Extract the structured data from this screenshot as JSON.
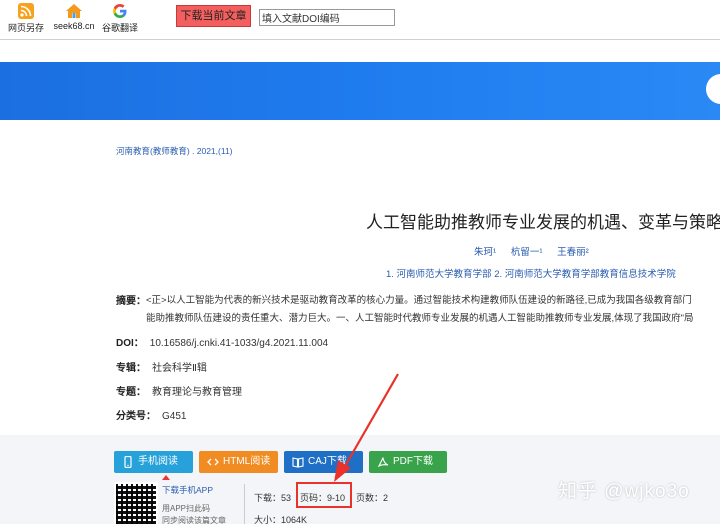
{
  "toolbar": {
    "items": [
      {
        "label": "网页另存",
        "icon": "rss-save-icon"
      },
      {
        "label": "seek68.cn",
        "icon": "home-icon"
      },
      {
        "label": "谷歌翻译",
        "icon": "google-icon"
      }
    ],
    "download_current": "下载当前文章",
    "doi_input_value": "填入文献DOI编码"
  },
  "article": {
    "source": "河南教育(教师教育) . 2021,(11)",
    "title": "人工智能助推教师专业发展的机遇、变革与策略",
    "authors": [
      "朱珂¹",
      "杭留一¹",
      "王春丽²"
    ],
    "affiliations": "1. 河南师范大学教育学部  2. 河南师范大学教育学部教育信息技术学院",
    "abstract_label": "摘要：",
    "abstract_line1": "<正>以人工智能为代表的新兴技术是驱动教育改革的核心力量。通过智能技术构建教师队伍建设的新路径,已成为我国各级教育部门",
    "abstract_line2": "能助推教师队伍建设的责任重大、潜力巨大。一、人工智能时代教师专业发展的机遇人工智能助推教师专业发展,体现了我国政府\"局",
    "doi_label": "DOI：",
    "doi_value": "10.16586/j.cnki.41-1033/g4.2021.11.004",
    "series_label": "专辑：",
    "series_value": "社会科学Ⅱ辑",
    "topic_label": "专题：",
    "topic_value": "教育理论与教育管理",
    "class_label": "分类号：",
    "class_value": "G451"
  },
  "actions": {
    "mobile_read": "手机阅读",
    "html_read": "HTML阅读",
    "caj_download": "CAJ下载",
    "pdf_download": "PDF下载"
  },
  "app": {
    "link": "下载手机APP",
    "sub1": "用APP扫此码",
    "sub2": "同步阅读该篇文章"
  },
  "stats": {
    "downloads": "下载：53",
    "page_numbers": "页码：9-10",
    "page_count": "页数：2",
    "size": "大小：1064K"
  },
  "watermark": "知乎 @wjko3o",
  "colors": {
    "banner_blue": "#1f7cee",
    "link_blue": "#2a5db0",
    "mobile_btn": "#26a1d9",
    "html_btn": "#f08c22",
    "caj_btn": "#1f6fc6",
    "pdf_btn": "#38a34a",
    "highlight_red": "#e8322a"
  }
}
